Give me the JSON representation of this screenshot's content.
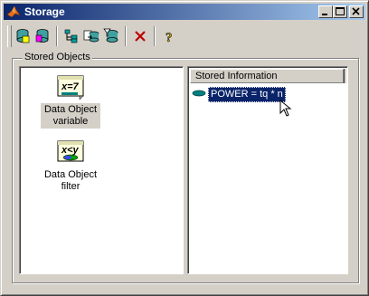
{
  "window": {
    "title": "Storage"
  },
  "toolbar": {
    "buttons": [
      {
        "icon": "store-database-icon"
      },
      {
        "icon": "retrieve-database-icon"
      },
      {
        "icon": "tree-view-icon"
      },
      {
        "icon": "copy-database-icon"
      },
      {
        "icon": "filter-database-icon"
      },
      {
        "icon": "delete-icon"
      },
      {
        "icon": "help-icon"
      }
    ]
  },
  "stored_objects": {
    "label": "Stored Objects",
    "items": [
      {
        "icon_text": "x=7",
        "label_line1": "Data Object",
        "label_line2": "variable",
        "selected": true
      },
      {
        "icon_text": "x<y",
        "label_line1": "Data Object",
        "label_line2": "filter",
        "selected": false
      }
    ]
  },
  "stored_information": {
    "header": "Stored Information",
    "rows": [
      {
        "text": "POWER = tq * n",
        "selected": true
      }
    ]
  }
}
